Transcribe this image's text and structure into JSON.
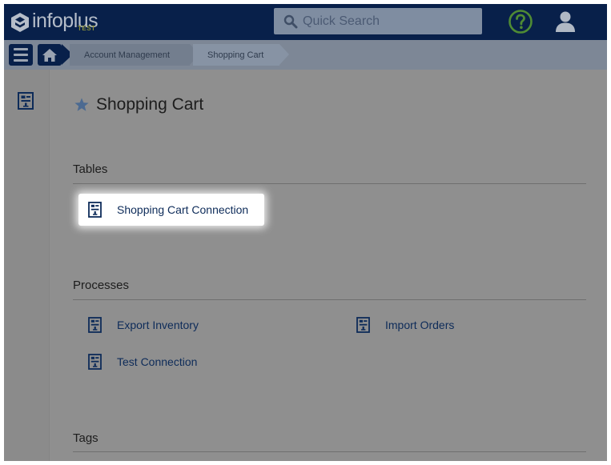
{
  "brand": {
    "name": "infoplus",
    "env": "TEST"
  },
  "search": {
    "placeholder": "Quick Search"
  },
  "breadcrumb": {
    "items": [
      "Account Management",
      "Shopping Cart"
    ]
  },
  "page": {
    "title": "Shopping Cart"
  },
  "sections": {
    "tables": {
      "title": "Tables",
      "items": [
        "Shopping Cart Connection"
      ]
    },
    "processes": {
      "title": "Processes",
      "items": [
        "Export Inventory",
        "Import Orders",
        "Test Connection"
      ]
    },
    "tags": {
      "title": "Tags"
    }
  },
  "icons": {
    "logo": "infoplus-logo-icon",
    "search": "search-icon",
    "help": "help-circle-icon",
    "user": "user-icon",
    "menu": "hamburger-menu-icon",
    "home": "home-icon",
    "star": "star-icon",
    "document": "document-table-icon"
  },
  "colors": {
    "navbar": "#08204a",
    "link": "#0d2b59",
    "help_green": "#6cc04a",
    "overlay_bg": "#8f8f8f",
    "highlight": "#ffffff"
  }
}
